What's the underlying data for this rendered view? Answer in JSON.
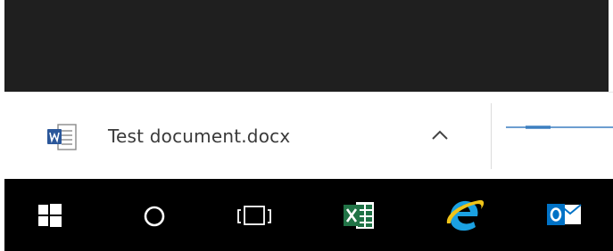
{
  "download": {
    "file_name": "Test document.docx",
    "file_icon": "word-document-icon",
    "expand_icon": "chevron-up-icon"
  },
  "taskbar": {
    "items": [
      {
        "name": "start-button",
        "icon": "windows-logo-icon"
      },
      {
        "name": "search-button",
        "icon": "cortana-circle-icon"
      },
      {
        "name": "task-view-button",
        "icon": "task-view-icon"
      },
      {
        "name": "excel-button",
        "icon": "excel-icon"
      },
      {
        "name": "internet-explorer-button",
        "icon": "internet-explorer-icon"
      },
      {
        "name": "outlook-button",
        "icon": "outlook-icon"
      }
    ]
  },
  "colors": {
    "taskbar_bg": "#000000",
    "page_top_bg": "#1f1f1f",
    "word_blue": "#2b579a",
    "excel_green": "#217346",
    "ie_blue": "#1ba1e2",
    "outlook_blue": "#0072c6",
    "progress_blue": "#3c7fc0"
  }
}
